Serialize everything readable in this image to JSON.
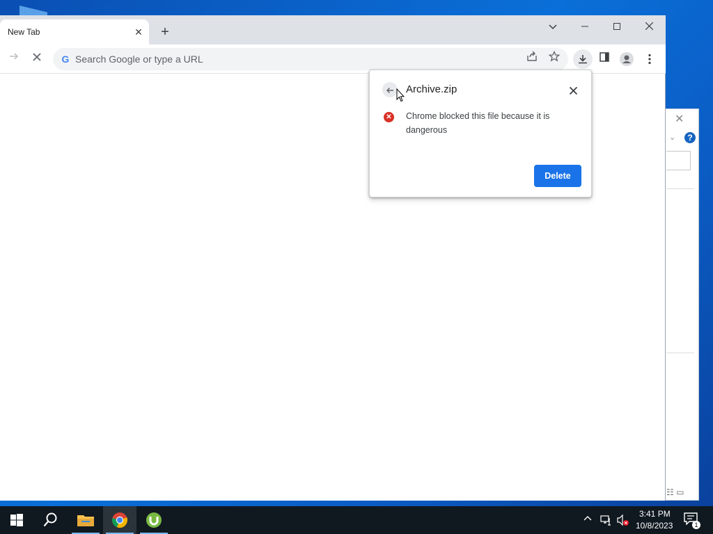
{
  "browser": {
    "tab": {
      "title": "New Tab"
    },
    "omnibox": {
      "placeholder": "Search Google or type a URL"
    }
  },
  "download_bubble": {
    "filename": "Archive.zip",
    "message": "Chrome blocked this file because it is dangerous",
    "delete_label": "Delete"
  },
  "taskbar": {
    "time": "3:41 PM",
    "date": "10/8/2023",
    "notification_count": "1"
  },
  "colors": {
    "accent": "#1a73e8",
    "error": "#d93025",
    "desktop": "#0a6fd8",
    "taskbar": "#101820"
  },
  "icons": {
    "browser": [
      "forward-icon",
      "stop-loading-icon",
      "google-g-icon",
      "share-icon",
      "bookmark-star-icon",
      "download-icon",
      "side-panel-icon",
      "profile-icon",
      "menu-icon"
    ],
    "taskbar": [
      "windows-start-icon",
      "search-icon",
      "file-explorer-icon",
      "chrome-icon",
      "utorrent-icon"
    ],
    "tray": [
      "chevron-up-icon",
      "network-icon",
      "volume-muted-icon",
      "notification-icon"
    ]
  }
}
